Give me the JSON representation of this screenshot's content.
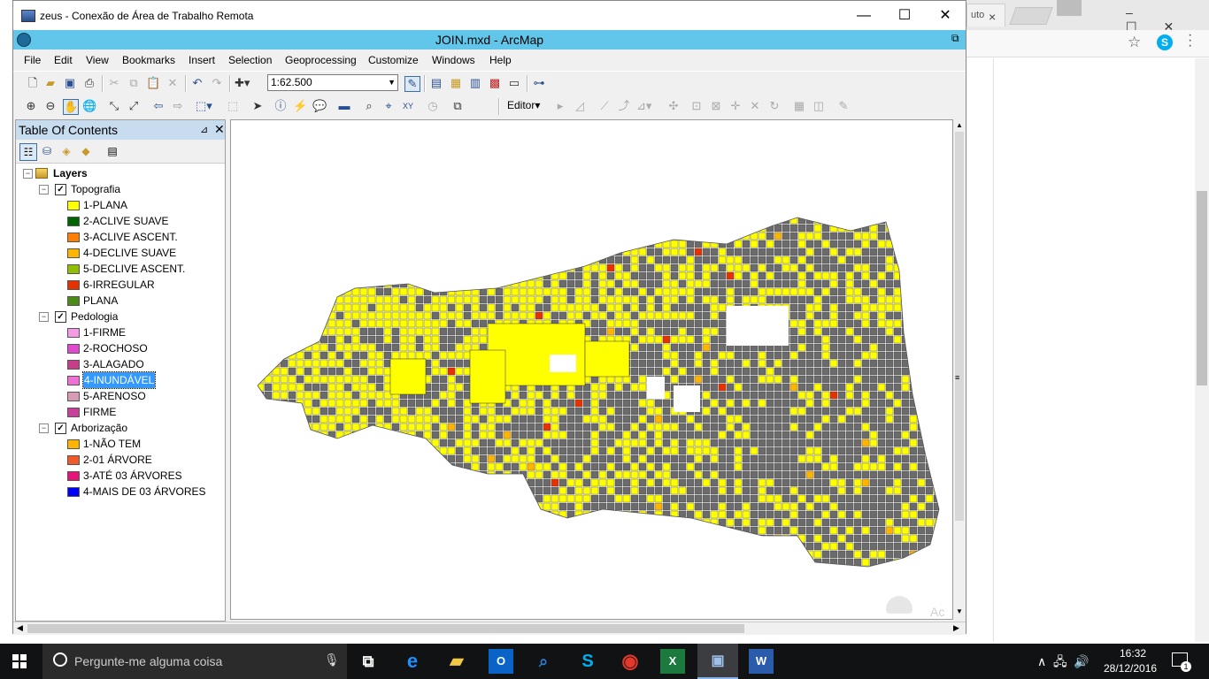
{
  "background_browser": {
    "tab_label": "uto",
    "tab_close": "×"
  },
  "rdp_window": {
    "title": "zeus - Conexão de Área de Trabalho Remota",
    "minimize": "—",
    "maximize": "☐",
    "close": "✕"
  },
  "arcmap": {
    "title": "JOIN.mxd - ArcMap",
    "menu": [
      "File",
      "Edit",
      "View",
      "Bookmarks",
      "Insert",
      "Selection",
      "Geoprocessing",
      "Customize",
      "Windows",
      "Help"
    ],
    "scale": "1:62.500",
    "editor_label": "Editor▾"
  },
  "toc": {
    "title": "Table Of Contents",
    "pin": "⊿",
    "close": "✕",
    "root": "Layers",
    "groups": [
      {
        "name": "Topografia",
        "items": [
          {
            "label": "1-PLANA",
            "color": "#ffff00"
          },
          {
            "label": "2-ACLIVE SUAVE",
            "color": "#006400"
          },
          {
            "label": "3-ACLIVE ASCENT.",
            "color": "#ff7f00"
          },
          {
            "label": "4-DECLIVE SUAVE",
            "color": "#ffb400"
          },
          {
            "label": "5-DECLIVE ASCENT.",
            "color": "#8fbf00"
          },
          {
            "label": "6-IRREGULAR",
            "color": "#e63200"
          },
          {
            "label": "PLANA",
            "color": "#4c8c14"
          }
        ]
      },
      {
        "name": "Pedologia",
        "items": [
          {
            "label": "1-FIRME",
            "color": "#f59ae6"
          },
          {
            "label": "2-ROCHOSO",
            "color": "#e04ad0"
          },
          {
            "label": "3-ALAGADO",
            "color": "#c83c8c"
          },
          {
            "label": "4-INUNDÁVEL",
            "color": "#f070d8"
          },
          {
            "label": "5-ARENOSO",
            "color": "#d89ab4"
          },
          {
            "label": "FIRME",
            "color": "#c8409c"
          }
        ]
      },
      {
        "name": "Arborização",
        "items": [
          {
            "label": "1-NÃO TEM",
            "color": "#ffb400"
          },
          {
            "label": "2-01 ÁRVORE",
            "color": "#f05a28"
          },
          {
            "label": "3-ATÉ 03 ÁRVORES",
            "color": "#e6147a"
          },
          {
            "label": "4-MAIS DE 03 ÁRVORES",
            "color": "#0000ff"
          }
        ]
      }
    ],
    "selected_item": "4-INUNDÁVEL"
  },
  "map": {
    "watermark": "Ac"
  },
  "taskbar": {
    "search_placeholder": "Pergunte-me alguma coisa",
    "time": "16:32",
    "date": "28/12/2016",
    "notification_count": "1"
  }
}
